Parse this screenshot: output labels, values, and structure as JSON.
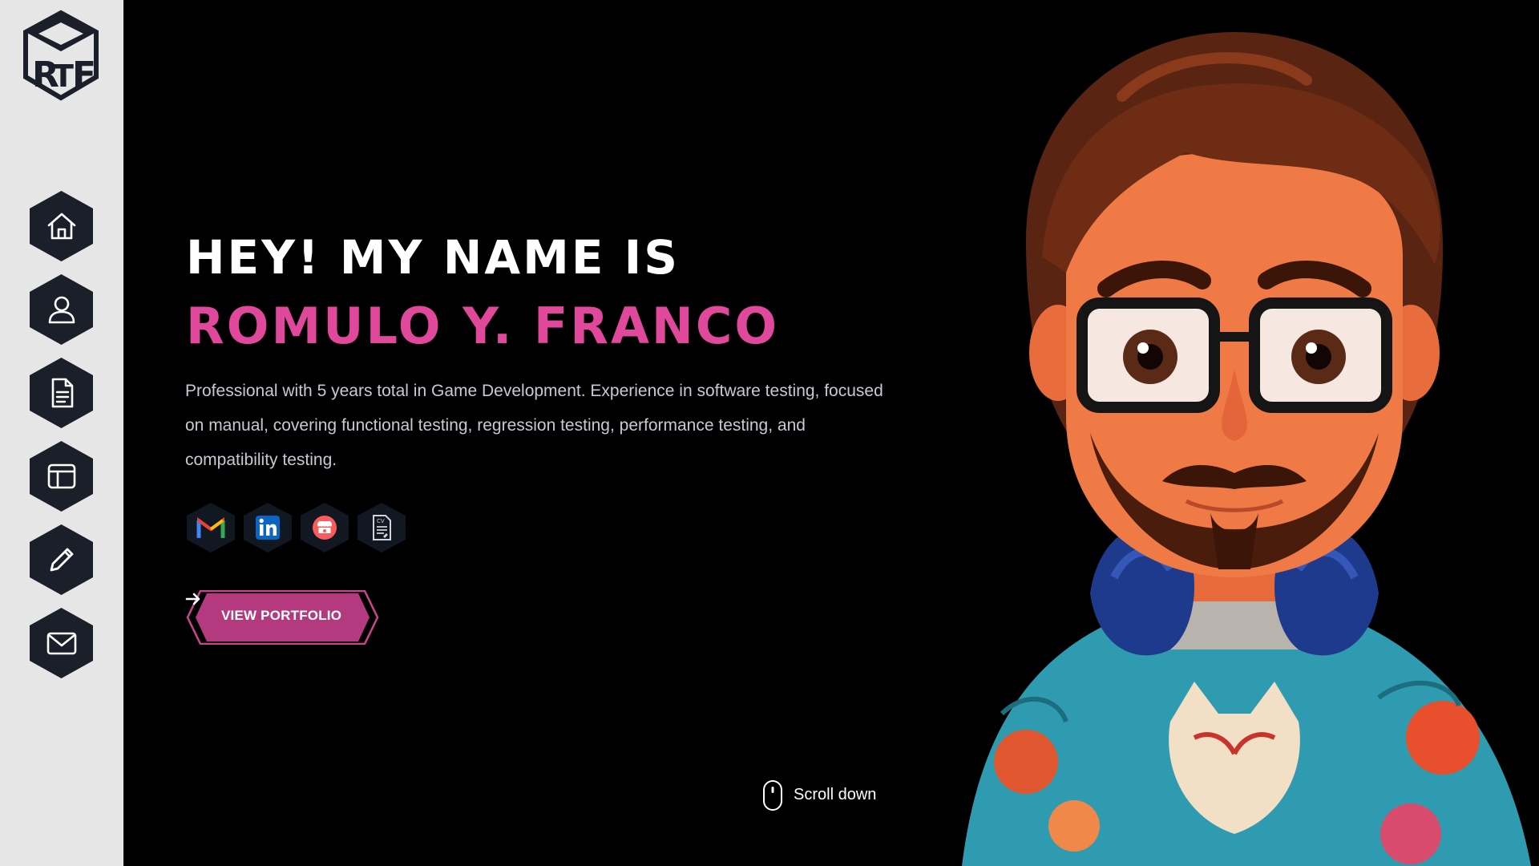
{
  "nav": {
    "logo_icon": "rtf-cube-logo",
    "items": [
      {
        "icon": "home-icon"
      },
      {
        "icon": "user-icon"
      },
      {
        "icon": "document-icon"
      },
      {
        "icon": "layout-icon"
      },
      {
        "icon": "pencil-icon"
      },
      {
        "icon": "mail-icon"
      }
    ]
  },
  "hero": {
    "greeting": "HEY! MY NAME IS",
    "name": "ROMULO Y. FRANCO",
    "description": "Professional with 5 years total in Game Development. Experience in software testing, focused on manual, covering functional testing, regression testing, performance testing, and compatibility testing."
  },
  "socials": [
    {
      "icon": "gmail-icon"
    },
    {
      "icon": "linkedin-icon"
    },
    {
      "icon": "itchio-icon"
    },
    {
      "icon": "cv-icon",
      "label": "CV"
    }
  ],
  "cta": {
    "label": "VIEW PORTFOLIO"
  },
  "scroll": {
    "label": "Scroll down",
    "icon": "mouse-icon"
  },
  "colors": {
    "accent": "#e0489b",
    "button": "#b43a7f",
    "sidebar": "#e6e6e6",
    "nav_hex": "#1a1f2a",
    "social_hex": "#111822",
    "background": "#000000"
  }
}
